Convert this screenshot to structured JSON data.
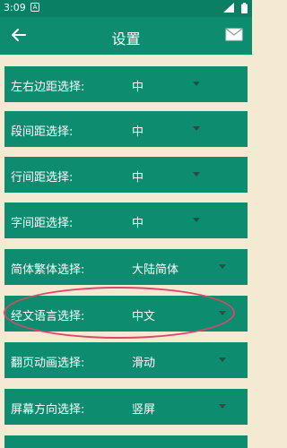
{
  "status_bar": {
    "time": "3:09",
    "badge": "A"
  },
  "app_bar": {
    "title": "设置"
  },
  "settings": [
    {
      "label": "左右边距选择:",
      "value": "中"
    },
    {
      "label": "段间距选择:",
      "value": "中"
    },
    {
      "label": "行间距选择:",
      "value": "中"
    },
    {
      "label": "字间距选择:",
      "value": "中"
    },
    {
      "label": "简体繁体选择:",
      "value": "大陆简体"
    },
    {
      "label": "经文语言选择:",
      "value": "中文"
    },
    {
      "label": "翻页动画选择:",
      "value": "滑动"
    },
    {
      "label": "屏幕方向选择:",
      "value": "竖屏"
    }
  ],
  "colors": {
    "primary": "#0e8c6f",
    "status_bar": "#0a7f64",
    "background": "#f4ead2",
    "highlight": "#d9486a",
    "caret": "#2a4a46"
  }
}
